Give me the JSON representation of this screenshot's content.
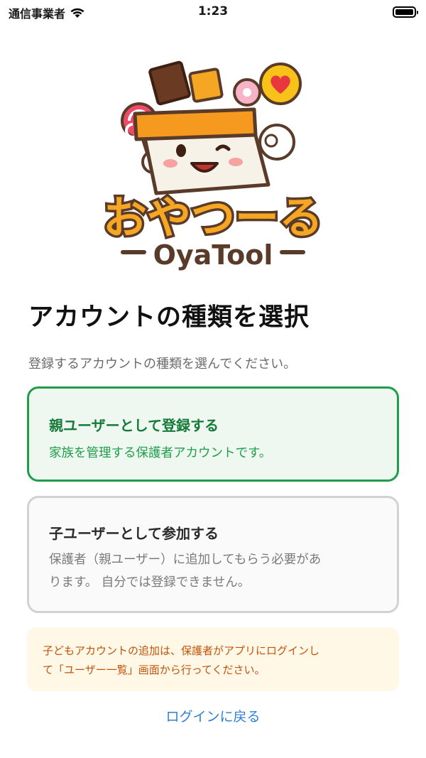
{
  "status_bar": {
    "carrier": "通信事業者",
    "time": "1:23"
  },
  "logo": {
    "title_jp": "おやつーる",
    "title_en": "OyaTool"
  },
  "page": {
    "title": "アカウントの種類を選択",
    "subtitle": "登録するアカウントの種類を選んでください。"
  },
  "options": [
    {
      "title": "親ユーザーとして登録する",
      "desc": "家族を管理する保護者アカウントです。",
      "selected": true
    },
    {
      "title": "子ユーザーとして参加する",
      "desc_line1": "保護者（親ユーザー）に追加してもらう必要があ",
      "desc_line2": "ります。 自分では登録できません。",
      "selected": false
    }
  ],
  "notice": {
    "line1": "子どもアカウントの追加は、保護者がアプリにログインし",
    "line2": "て「ユーザー一覧」画面から行ってください。"
  },
  "back_link": "ログインに戻る",
  "colors": {
    "accent_green": "#1f9e4a",
    "link_blue": "#2f7fd6",
    "notice_orange": "#c4530a",
    "notice_bg": "#fff8e6"
  }
}
